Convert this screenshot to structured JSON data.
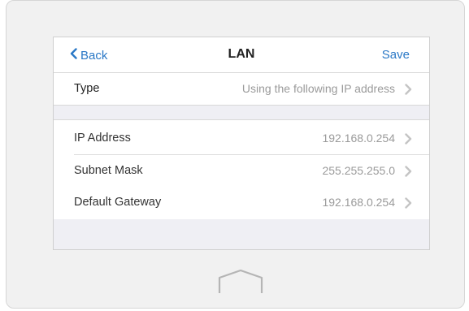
{
  "navbar": {
    "back_label": "Back",
    "title": "LAN",
    "save_label": "Save"
  },
  "type_row": {
    "label": "Type",
    "value": "Using the following IP address"
  },
  "settings": [
    {
      "label": "IP Address",
      "value": "192.168.0.254"
    },
    {
      "label": "Subnet Mask",
      "value": "255.255.255.0"
    },
    {
      "label": "Default Gateway",
      "value": "192.168.0.254"
    }
  ],
  "colors": {
    "accent": "#2a78c6",
    "background": "#efeff4",
    "value_text": "#9a9a9a"
  },
  "icons": {
    "back": "chevron-left-icon",
    "disclosure": "chevron-right-icon",
    "home": "home-icon"
  }
}
